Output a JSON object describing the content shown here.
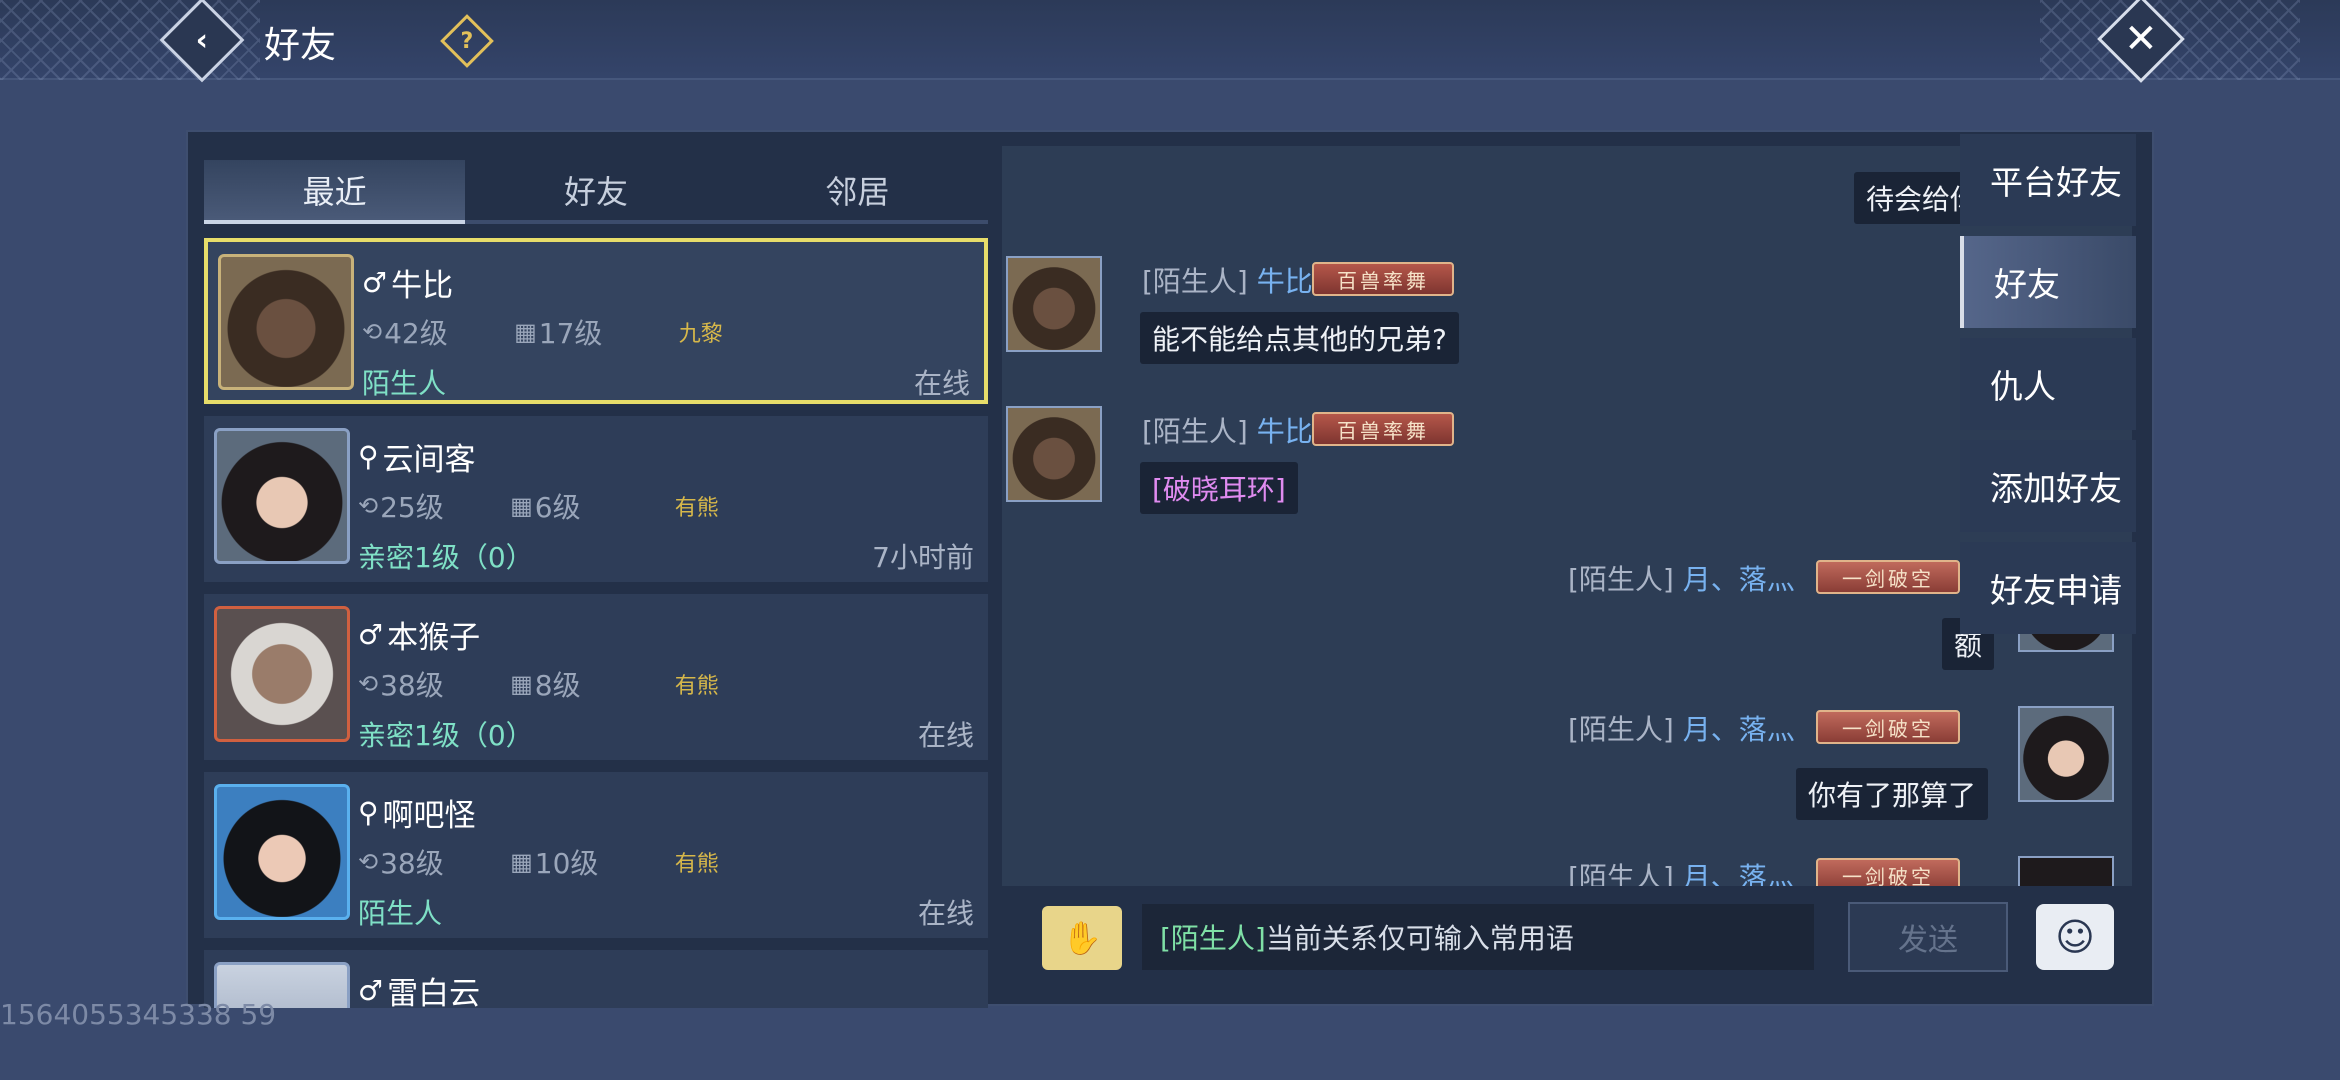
{
  "header": {
    "title": "好友",
    "back_icon": "‹",
    "help_icon": "?",
    "close_icon": "✕"
  },
  "tabs": [
    {
      "label": "最近",
      "active": true
    },
    {
      "label": "好友",
      "active": false
    },
    {
      "label": "邻居",
      "active": false
    }
  ],
  "friends": [
    {
      "gender": "♂",
      "name": "牛比",
      "level": "42级",
      "rank": "17级",
      "sect": "九黎",
      "relation": "陌生人",
      "status": "在线",
      "avatar": "bull",
      "selected": true
    },
    {
      "gender": "⚲",
      "name": "云间客",
      "level": "25级",
      "rank": "6级",
      "sect": "有熊",
      "relation": "亲密1级（0）",
      "status": "7小时前",
      "avatar": "girl"
    },
    {
      "gender": "♂",
      "name": "本猴子",
      "level": "38级",
      "rank": "8级",
      "sect": "有熊",
      "relation": "亲密1级（0）",
      "status": "在线",
      "avatar": "monkey"
    },
    {
      "gender": "⚲",
      "name": "啊吧怪",
      "level": "38级",
      "rank": "10级",
      "sect": "有熊",
      "relation": "陌生人",
      "status": "在线",
      "avatar": "woman"
    },
    {
      "gender": "♂",
      "name": "雷白云",
      "avatar": "white"
    }
  ],
  "chat": {
    "messages": [
      {
        "side": "right",
        "text": "待会给你"
      },
      {
        "side": "left",
        "sender_prefix": "[陌生人]",
        "sender_name": "牛比",
        "badge": "百兽率舞",
        "text": "能不能给点其他的兄弟?"
      },
      {
        "side": "left",
        "sender_prefix": "[陌生人]",
        "sender_name": "牛比",
        "badge": "百兽率舞",
        "text": "[破晓耳环]"
      },
      {
        "side": "right",
        "sender_prefix": "[陌生人]",
        "sender_name": "月、落灬",
        "badge": "一剑破空",
        "text": "额"
      },
      {
        "side": "right",
        "sender_prefix": "[陌生人]",
        "sender_name": "月、落灬",
        "badge": "一剑破空",
        "text": "你有了那算了"
      },
      {
        "side": "right",
        "sender_prefix": "[陌生人]",
        "sender_name": "月、落灬",
        "badge": "一剑破空",
        "text": ""
      }
    ],
    "input_tag": "[陌生人]",
    "input_text": "当前关系仅可输入常用语",
    "send_label": "发送"
  },
  "side_menu": [
    {
      "label": "平台好友",
      "active": false
    },
    {
      "label": "好友",
      "active": true
    },
    {
      "label": "仇人",
      "active": false
    },
    {
      "label": "添加好友",
      "active": false
    },
    {
      "label": "好友申请",
      "active": false
    }
  ],
  "watermark": "1564055345338 59"
}
